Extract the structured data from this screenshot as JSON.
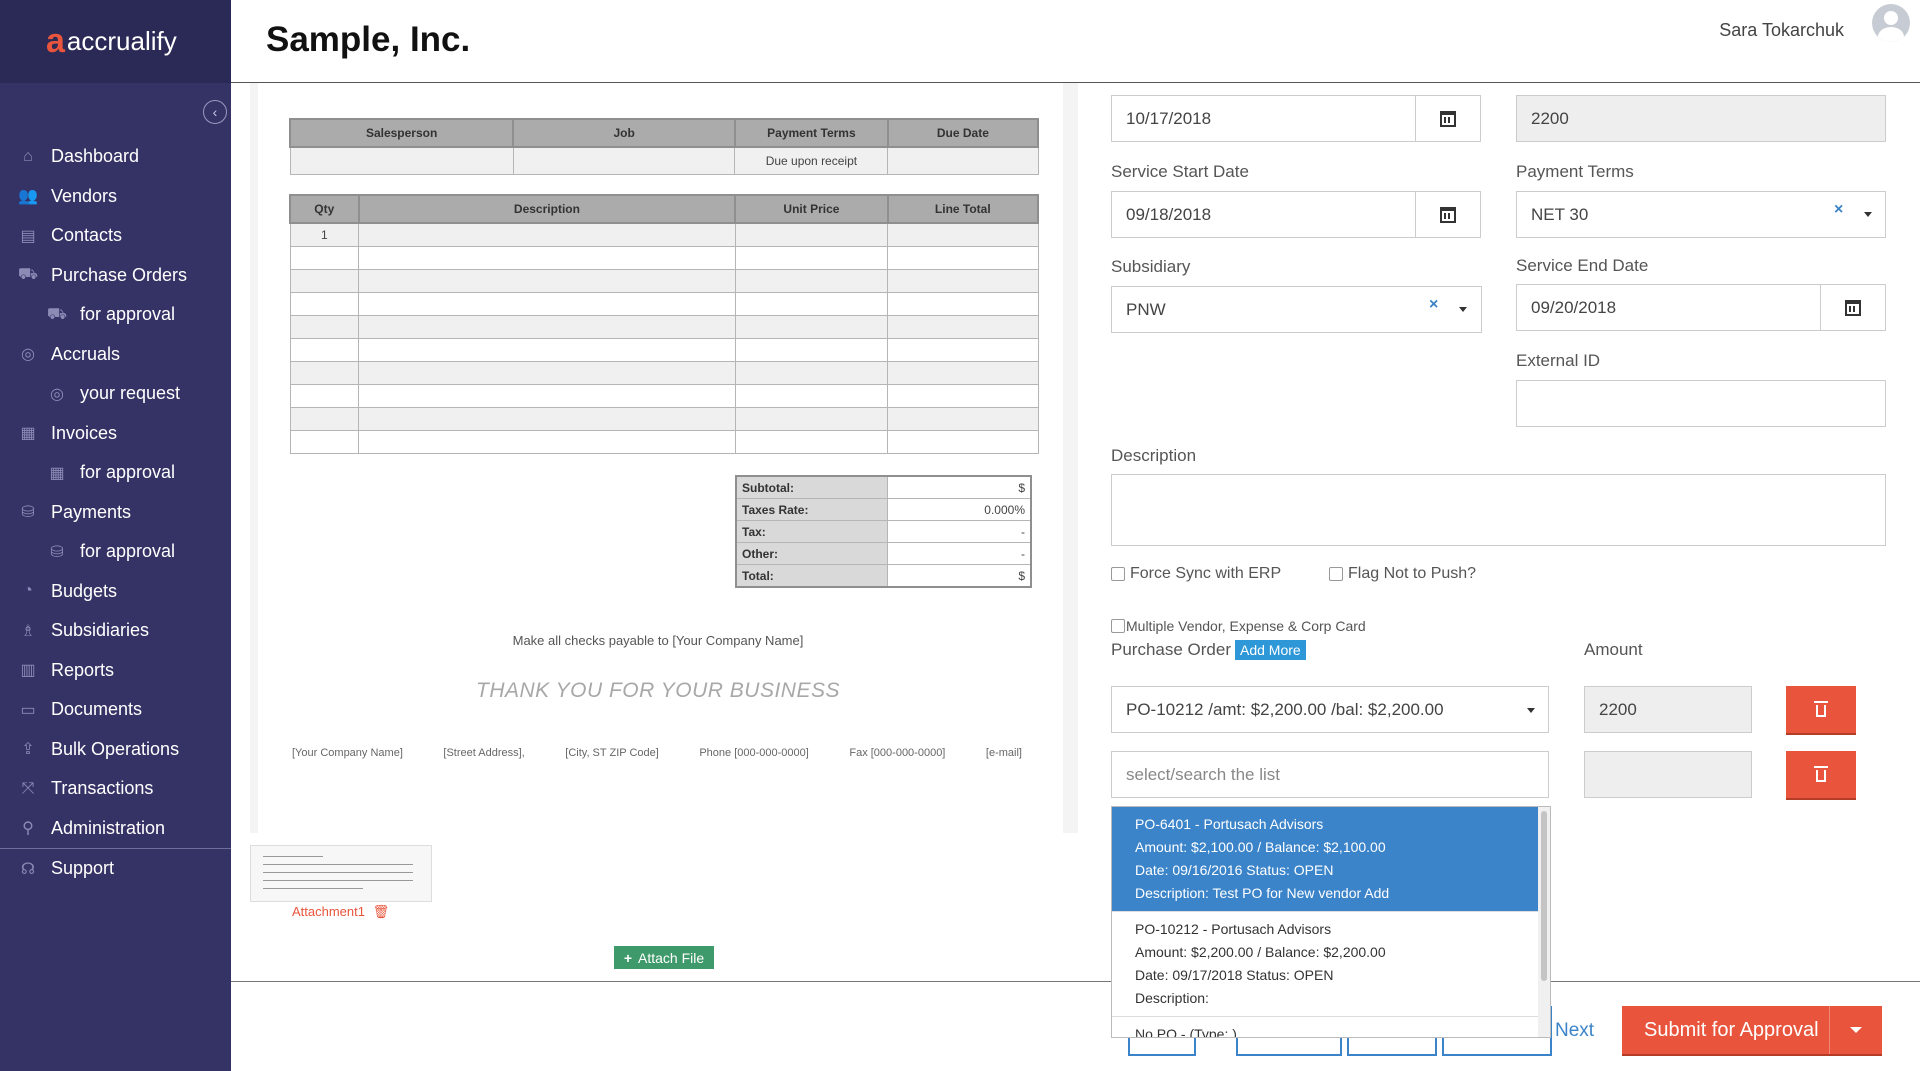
{
  "app": {
    "logo": "accrualify",
    "company": "Sample, Inc.",
    "user": "Sara Tokarchuk"
  },
  "sidebar": {
    "items": [
      {
        "label": "Dashboard",
        "icon": "home-icon"
      },
      {
        "label": "Vendors",
        "icon": "users-icon"
      },
      {
        "label": "Contacts",
        "icon": "contacts-icon"
      },
      {
        "label": "Purchase Orders",
        "icon": "cart-icon"
      },
      {
        "label": "for approval",
        "icon": "cart-icon"
      },
      {
        "label": "Accruals",
        "icon": "target-icon"
      },
      {
        "label": "your request",
        "icon": "target-icon"
      },
      {
        "label": "Invoices",
        "icon": "invoice-icon"
      },
      {
        "label": "for approval",
        "icon": "invoice-icon"
      },
      {
        "label": "Payments",
        "icon": "payment-icon"
      },
      {
        "label": "for approval",
        "icon": "payment-icon"
      },
      {
        "label": "Budgets",
        "icon": "pie-icon"
      },
      {
        "label": "Subsidiaries",
        "icon": "org-icon"
      },
      {
        "label": "Reports",
        "icon": "bar-chart-icon"
      },
      {
        "label": "Documents",
        "icon": "archive-icon"
      },
      {
        "label": "Bulk Operations",
        "icon": "upload-icon"
      },
      {
        "label": "Transactions",
        "icon": "transactions-icon"
      },
      {
        "label": "Administration",
        "icon": "search-icon"
      },
      {
        "label": "Support",
        "icon": "headset-icon"
      }
    ]
  },
  "invoice_doc": {
    "top_headers": [
      "Salesperson",
      "Job",
      "Payment Terms",
      "Due Date"
    ],
    "top_values": [
      "",
      "",
      "Due upon receipt",
      ""
    ],
    "line_headers": [
      "Qty",
      "Description",
      "Unit Price",
      "Line Total"
    ],
    "first_qty": "1",
    "totals": [
      {
        "label": "Subtotal:",
        "value": "$"
      },
      {
        "label": "Taxes Rate:",
        "value": "0.000%"
      },
      {
        "label": "Tax:",
        "value": "-"
      },
      {
        "label": "Other:",
        "value": "-"
      },
      {
        "label": "Total:",
        "value": "$"
      }
    ],
    "checks_note": "Make all checks payable to [Your Company Name]",
    "thanks": "THANK YOU FOR YOUR BUSINESS",
    "footer": [
      "[Your Company Name]",
      "[Street Address],",
      "[City, ST ZIP Code]",
      "Phone [000-000-0000]",
      "Fax [000-000-0000]",
      "[e-mail]"
    ]
  },
  "attachment": {
    "name": "Attachment1",
    "attach_label": "Attach File"
  },
  "form": {
    "date_value": "10/17/2018",
    "amount_top": "2200",
    "service_start_label": "Service Start Date",
    "service_start_value": "09/18/2018",
    "payment_terms_label": "Payment Terms",
    "payment_terms_value": "NET 30",
    "subsidiary_label": "Subsidiary",
    "subsidiary_value": "PNW",
    "service_end_label": "Service End Date",
    "service_end_value": "09/20/2018",
    "external_id_label": "External ID",
    "external_id_value": "",
    "description_label": "Description",
    "force_sync_label": "Force Sync with ERP",
    "flag_push_label": "Flag Not to Push?",
    "multi_vendor_label": "Multiple Vendor, Expense & Corp Card",
    "po_label": "Purchase Order",
    "add_more": "Add More",
    "amount_label": "Amount",
    "po_selected": "PO-10212 /amt: $2,200.00 /bal: $2,200.00",
    "po_amount": "2200",
    "search_placeholder": "select/search the list"
  },
  "dropdown": {
    "options": [
      {
        "l1": "PO-6401 - Portusach Advisors",
        "l2": "Amount: $2,100.00 / Balance: $2,100.00",
        "l3": "Date: 09/16/2016 Status: OPEN",
        "l4": "Description: Test PO for New vendor Add"
      },
      {
        "l1": "PO-10212 - Portusach Advisors",
        "l2": "Amount: $2,200.00 / Balance: $2,200.00",
        "l3": "Date: 09/17/2018 Status: OPEN",
        "l4": "Description:"
      },
      {
        "l1": "No PO - (Type: )"
      }
    ]
  },
  "actions": {
    "next": "Next",
    "submit": "Submit for Approval"
  },
  "colors": {
    "sidebar": "#353365",
    "accent": "#e8553c",
    "primary": "#3b84c9"
  }
}
